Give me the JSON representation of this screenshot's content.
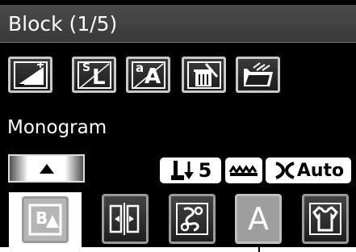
{
  "title": "Block (1/5)",
  "toolbar": {
    "icons": [
      "size-adjust-icon",
      "small-large-icon",
      "font-style-icon",
      "delete-icon",
      "open-folder-icon"
    ],
    "sl_letters": {
      "s": "S",
      "l": "L"
    },
    "font_letters": {
      "a_small": "a",
      "a_big": "A"
    }
  },
  "section_label": "Monogram",
  "status": {
    "tension_value": "5",
    "auto_label": "Auto"
  },
  "tabs": {
    "active_label": "B",
    "font_tab_letter": "A",
    "items": [
      "border-icon",
      "split-stitch-icon",
      "pattern-icon",
      "font-icon",
      "shirt-icon"
    ]
  }
}
